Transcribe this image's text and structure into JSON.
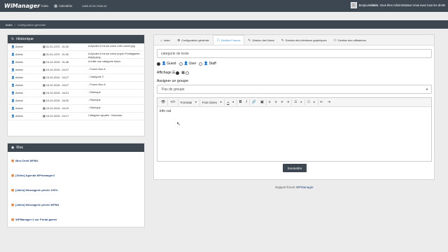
{
  "topbar": {
    "brand": "WiManager",
    "nav": [
      {
        "label": "Index",
        "icon": "home-icon"
      },
      {
        "label": "Calendrier",
        "icon": "calendar-icon"
      }
    ],
    "uuid": "4409-0719-7208-10",
    "user": {
      "greeting": "Bonjour",
      "name": "Admin",
      "role_text": ". Vous êtes Administrateur.",
      "rights_text": "Vous avez tous les droits"
    }
  },
  "breadcrumb": {
    "home": "Index",
    "current": "Configuration générale"
  },
  "history": {
    "title": "Historique",
    "rows": [
      {
        "user": "Admin",
        "date": "01-01-1970 - 01:00",
        "action": "A Ajouter le forum icône c150-carrré.jpg"
      },
      {
        "user": "Admin",
        "date": "01-01-1970 - 01:00",
        "action": "A Ajouter le forum icône (super Portalgamer-empty.png"
      },
      {
        "user": "Admin",
        "date": "15-10-2015 - 01:48",
        "action": "A édité une catégorie forum"
      },
      {
        "user": "Admin",
        "date": "15-10-2015 - 04:27",
        "action": "- Forum bloc A"
      },
      {
        "user": "Admin",
        "date": "15-10-2015 - 04:27",
        "action": "- Catégorie 2"
      },
      {
        "user": "Admin",
        "date": "15-10-2015 - 04:27",
        "action": "- Forum bloc A"
      },
      {
        "user": "Admin",
        "date": "15-10-2015 - 04:21",
        "action": "- Rubrique"
      },
      {
        "user": "Admin",
        "date": "15-10-2015 - 04:20",
        "action": "- Rubrique"
      },
      {
        "user": "Admin",
        "date": "15-10-2015 - 04:19",
        "action": "- Rubrique"
      },
      {
        "user": "Admin",
        "date": "15-10-2015 - 04:17",
        "action": "Catégorie ajoutée : Nouveau"
      }
    ]
  },
  "rss": {
    "title": "Rss",
    "items": [
      "Bloc Droit WPM4",
      "[Vidéo] Agenda WPmanager4",
      "[vidéo] Messagerie privée 100%",
      "[vidéo] Messagerie privée WPM4",
      "WPManager 4 sur Portal-gamer"
    ]
  },
  "tabs": [
    {
      "label": "Index",
      "icon": "home-icon",
      "active": false
    },
    {
      "label": "Configuration générale",
      "icon": "gear-icon",
      "active": false
    },
    {
      "label": "Gestion Forums",
      "icon": "forum-icon",
      "active": true
    },
    {
      "label": "Gestion des News",
      "icon": "pencil-icon",
      "active": false
    },
    {
      "label": "Gestion des interfaces graphiques",
      "icon": "pencil-icon",
      "active": false
    },
    {
      "label": "Gestion des utilisateurs",
      "icon": "users-icon",
      "active": false
    }
  ],
  "form": {
    "title_value": "categorie de teste",
    "roles": [
      "Guest",
      "User",
      "Staff"
    ],
    "display_label": "Affichage",
    "assign_label": "Assigner un groupe",
    "group_select": "Pas de groupe",
    "editor": {
      "formats": "Formats",
      "font_sizes": "Font Sizes",
      "font_color": "A",
      "bold": "B",
      "italic": "I",
      "body": "info cat"
    },
    "submit": "Soumettre"
  },
  "footer": {
    "support_label": "Support forum",
    "support_link": "WPManager"
  }
}
